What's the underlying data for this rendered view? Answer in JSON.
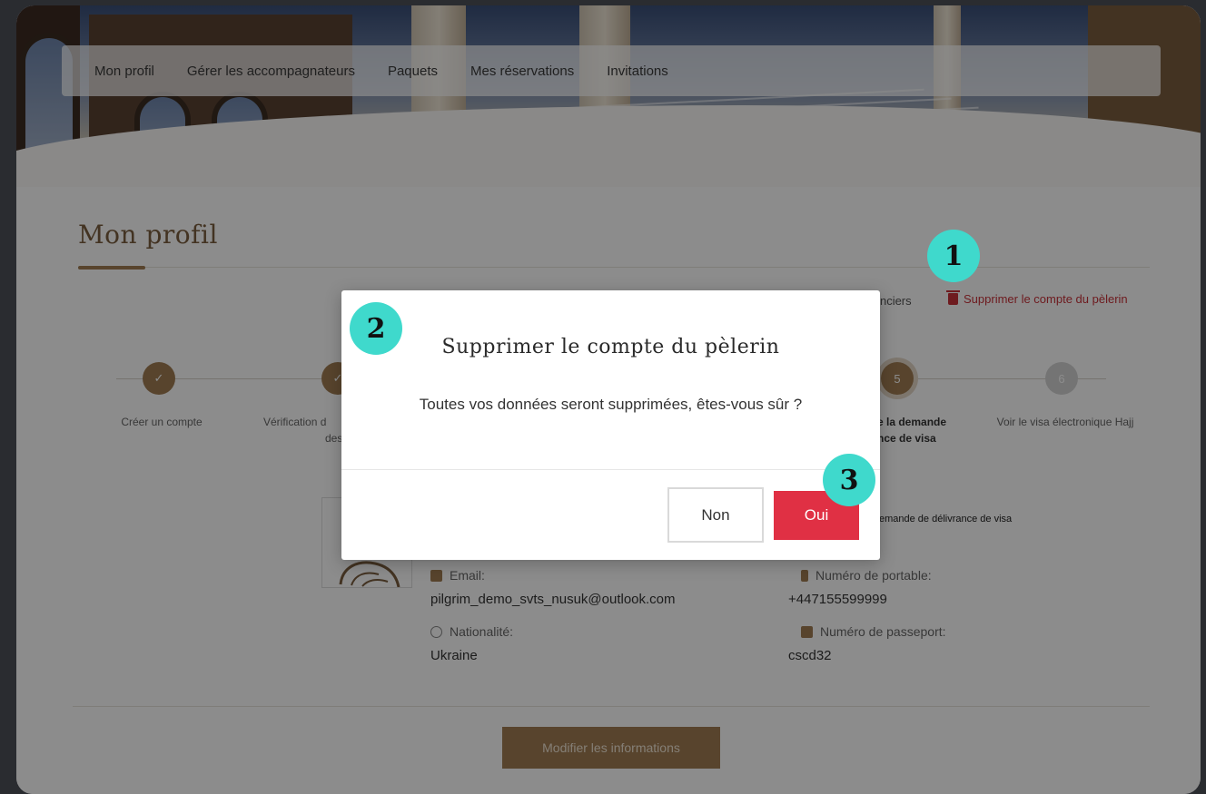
{
  "nav": {
    "items": [
      "Mon profil",
      "Gérer les accompagnateurs",
      "Paquets",
      "Mes réservations",
      "Invitations"
    ]
  },
  "page": {
    "title": "Mon profil",
    "actions": {
      "financial_label": "financiers",
      "delete_label": "Supprimer le compte du pèlerin"
    }
  },
  "stepper": {
    "steps": [
      {
        "number": "",
        "label": "Créer un compte",
        "state": "done"
      },
      {
        "number": "",
        "label": "Vérification d",
        "label2": "des doc",
        "state": "done"
      },
      {
        "number": "5",
        "label": "e la demande",
        "label2": "nce de visa",
        "state": "active"
      },
      {
        "number": "6",
        "label": "Voir le visa électronique Hajj",
        "state": "todo"
      }
    ]
  },
  "profile": {
    "visa_note": "emande de délivrance de visa",
    "email_label": "Email:",
    "email_value": "pilgrim_demo_svts_nusuk@outlook.com",
    "mobile_label": "Numéro de portable:",
    "mobile_value": "+447155599999",
    "nationality_label": "Nationalité:",
    "nationality_value": "Ukraine",
    "passport_label": "Numéro de passeport:",
    "passport_value": "cscd32",
    "modify_button": "Modifier les informations"
  },
  "modal": {
    "title": "Supprimer le compte du pèlerin",
    "message": "Toutes vos données seront supprimées, êtes-vous sûr ?",
    "no_label": "Non",
    "yes_label": "Oui"
  },
  "annotations": {
    "badge1": "1",
    "badge2": "2",
    "badge3": "3"
  },
  "colors": {
    "accent": "#a07d52",
    "danger": "#e03044",
    "badge": "#3fd9cc"
  }
}
